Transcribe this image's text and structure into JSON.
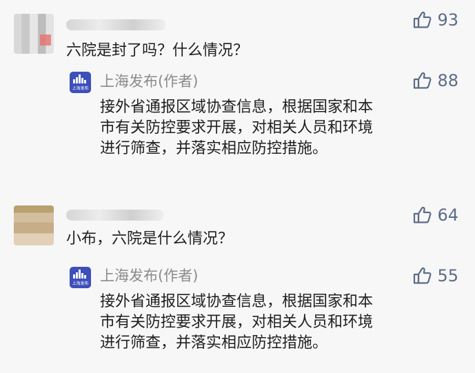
{
  "comments": [
    {
      "likes": "93",
      "text": "六院是封了吗？什么情况？",
      "reply": {
        "author": "上海发布(作者)",
        "likes": "88",
        "lines": [
          "接外省通报区域协查信息，根据国家和本",
          "市有关防控要求开展，对相关人员和环境",
          "进行筛查，并落实相应防控措施。"
        ]
      }
    },
    {
      "likes": "64",
      "text": "小布，六院是什么情况？",
      "reply": {
        "author": "上海发布(作者)",
        "likes": "55",
        "lines": [
          "接外省通报区域协查信息，根据国家和本",
          "市有关防控要求开展，对相关人员和环境",
          "进行筛查，并落实相应防控措施。"
        ]
      }
    }
  ],
  "official_avatar_label": "上海发布",
  "icons": {
    "like": "thumbs-up-icon"
  },
  "colors": {
    "background": "#f7f7f7",
    "like_text": "#5c6c87",
    "author_text": "#8a8a8a",
    "official_avatar_bg": "#3c4fba"
  }
}
